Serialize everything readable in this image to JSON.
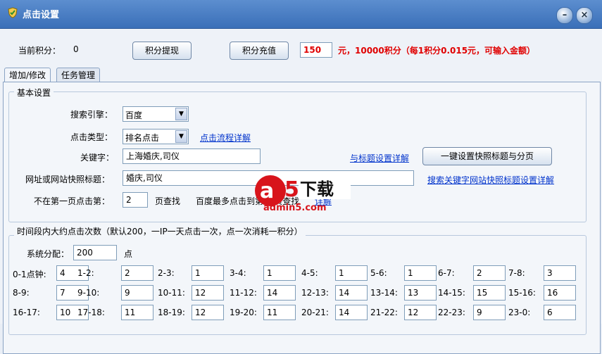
{
  "window": {
    "title": "点击设置",
    "minimize_glyph": "–",
    "close_glyph": "×"
  },
  "top": {
    "points_label": "当前积分：",
    "points_value": "0",
    "withdraw_btn": "积分提现",
    "recharge_btn": "积分充值",
    "recharge_amount": "150",
    "recharge_note": "元，10000积分（每1积分0.015元，可输入金额）"
  },
  "tabs": [
    "增加/修改",
    "任务管理"
  ],
  "basic": {
    "group_title": "基本设置",
    "engine_label": "搜索引擎：",
    "engine_value": "百度",
    "click_type_label": "点击类型：",
    "click_type_value": "排名点击",
    "click_flow_link": "点击流程详解",
    "keyword_label": "关键字：",
    "keyword_value": "上海婚庆,司仪",
    "title_setup_link": "与标题设置详解",
    "one_click_btn": "一键设置快照标题与分页",
    "url_label": "网址或网站快照标题：",
    "url_value": "婚庆,司仪",
    "search_setup_link": "搜索关键字网站快照标题设置详解",
    "not_first_label": "不在第一页点击第：",
    "not_first_value": "2",
    "page_find": "页查找",
    "baidu_max": "百度最多点击到第10页查找",
    "detail_link": "详解"
  },
  "timeslots": {
    "group_title": "时间段内大约点击次数（默认200，一IP一天点击一次，点一次消耗一积分）",
    "system_label": "系统分配：",
    "system_value": "200",
    "system_unit": "点",
    "rows": [
      [
        [
          "0-1点钟:",
          "4"
        ],
        [
          "1-2:",
          "2"
        ],
        [
          "2-3:",
          "1"
        ],
        [
          "3-4:",
          "1"
        ],
        [
          "4-5:",
          "1"
        ],
        [
          "5-6:",
          "1"
        ],
        [
          "6-7:",
          "2"
        ],
        [
          "7-8:",
          "3"
        ]
      ],
      [
        [
          "8-9:",
          "7"
        ],
        [
          "9-10:",
          "9"
        ],
        [
          "10-11:",
          "12"
        ],
        [
          "11-12:",
          "14"
        ],
        [
          "12-13:",
          "14"
        ],
        [
          "13-14:",
          "13"
        ],
        [
          "14-15:",
          "15"
        ],
        [
          "15-16:",
          "16"
        ]
      ],
      [
        [
          "16-17:",
          "10"
        ],
        [
          "17-18:",
          "11"
        ],
        [
          "18-19:",
          "12"
        ],
        [
          "19-20:",
          "11"
        ],
        [
          "20-21:",
          "14"
        ],
        [
          "21-22:",
          "12"
        ],
        [
          "22-23:",
          "9"
        ],
        [
          "23-0:",
          "6"
        ]
      ]
    ]
  },
  "watermark": {
    "logo_text": "a5下载",
    "site": "admin5.com"
  },
  "colors": {
    "titlebar": "#4a7fc4",
    "accent_red": "#e00000",
    "link": "#0033cc"
  }
}
